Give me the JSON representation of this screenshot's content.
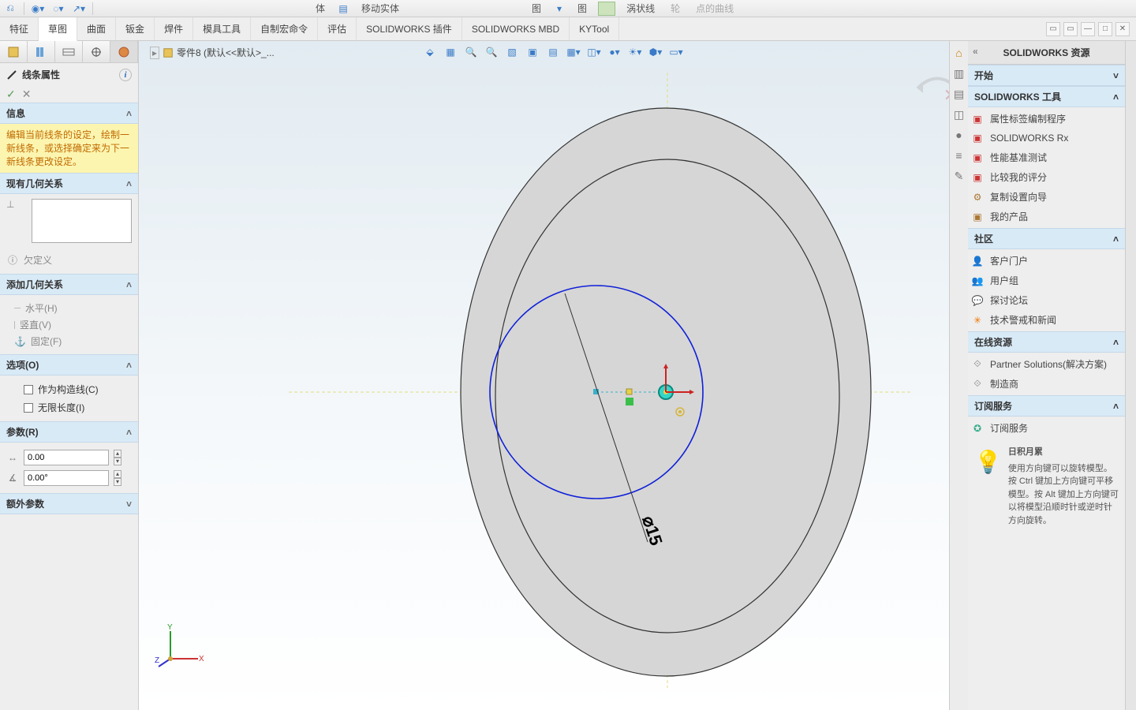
{
  "top_toolbar": {
    "items": [
      "体",
      "移动实体",
      "图",
      "图",
      "涡状线",
      "轮",
      "点的曲线"
    ]
  },
  "ribbon": {
    "tabs": [
      "特征",
      "草图",
      "曲面",
      "钣金",
      "焊件",
      "模具工具",
      "自制宏命令",
      "评估",
      "SOLIDWORKS 插件",
      "SOLIDWORKS MBD",
      "KYTool"
    ],
    "active_index": 1
  },
  "document_tab": "零件8  (默认<<默认>_...",
  "pm": {
    "title": "线条属性",
    "okcancel": {
      "ok": "✓",
      "cancel": "✕"
    },
    "info_head": "信息",
    "info_body": "编辑当前线条的设定，绘制一新线条，或选择确定来为下一新线条更改设定。",
    "relations_head": "现有几何关系",
    "under_defined": "欠定义",
    "add_relations_head": "添加几何关系",
    "rel_items": [
      {
        "label": "水平(H)"
      },
      {
        "label": "竖直(V)"
      },
      {
        "label": "固定(F)"
      }
    ],
    "options_head": "选项(O)",
    "opt_construction": "作为构造线(C)",
    "opt_infinite": "无限长度(I)",
    "params_head": "参数(R)",
    "param_length": "0.00",
    "param_angle": "0.00°",
    "extra_head": "额外参数"
  },
  "sketch": {
    "dim_label": "⌀15"
  },
  "resources": {
    "panel_title": "SOLIDWORKS 资源",
    "start_head": "开始",
    "tools_head": "SOLIDWORKS 工具",
    "tools": [
      "属性标签编制程序",
      "SOLIDWORKS Rx",
      "性能基准测试",
      "比较我的评分",
      "复制设置向导",
      "我的产品"
    ],
    "community_head": "社区",
    "community": [
      "客户门户",
      "用户组",
      "探讨论坛",
      "技术警戒和新闻"
    ],
    "online_head": "在线资源",
    "online": [
      "Partner Solutions(解决方案)",
      "制造商"
    ],
    "subscribe_head": "订阅服务",
    "subscribe": [
      "订阅服务"
    ],
    "tip_title": "日积月累",
    "tip_body": "使用方向键可以旋转模型。按 Ctrl 键加上方向键可平移模型。按 Alt 键加上方向键可以将模型沿顺时针或逆时针方向旋转。"
  }
}
